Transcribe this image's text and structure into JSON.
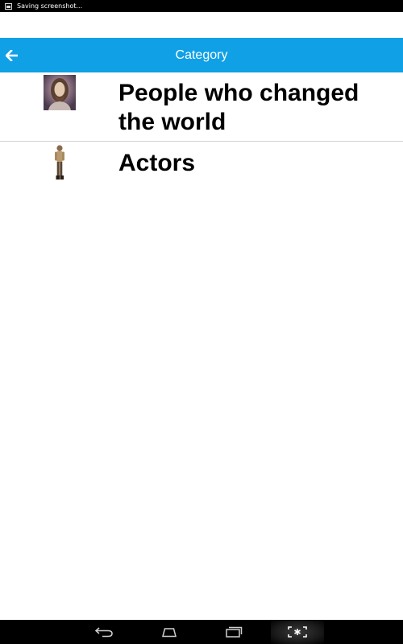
{
  "status_bar": {
    "icon": "screenshot-notification-icon",
    "text": "Saving screenshot..."
  },
  "action_bar": {
    "title": "Category",
    "back_icon": "arrow-left-icon",
    "color": "#0fa0e6"
  },
  "categories": [
    {
      "label": "People who changed the world",
      "icon": "portrait-thumbnail"
    },
    {
      "label": "Actors",
      "icon": "actor-figure-thumbnail"
    }
  ],
  "nav_bar": {
    "buttons": [
      "back-icon",
      "home-icon",
      "recent-apps-icon",
      "screenshot-icon"
    ]
  }
}
